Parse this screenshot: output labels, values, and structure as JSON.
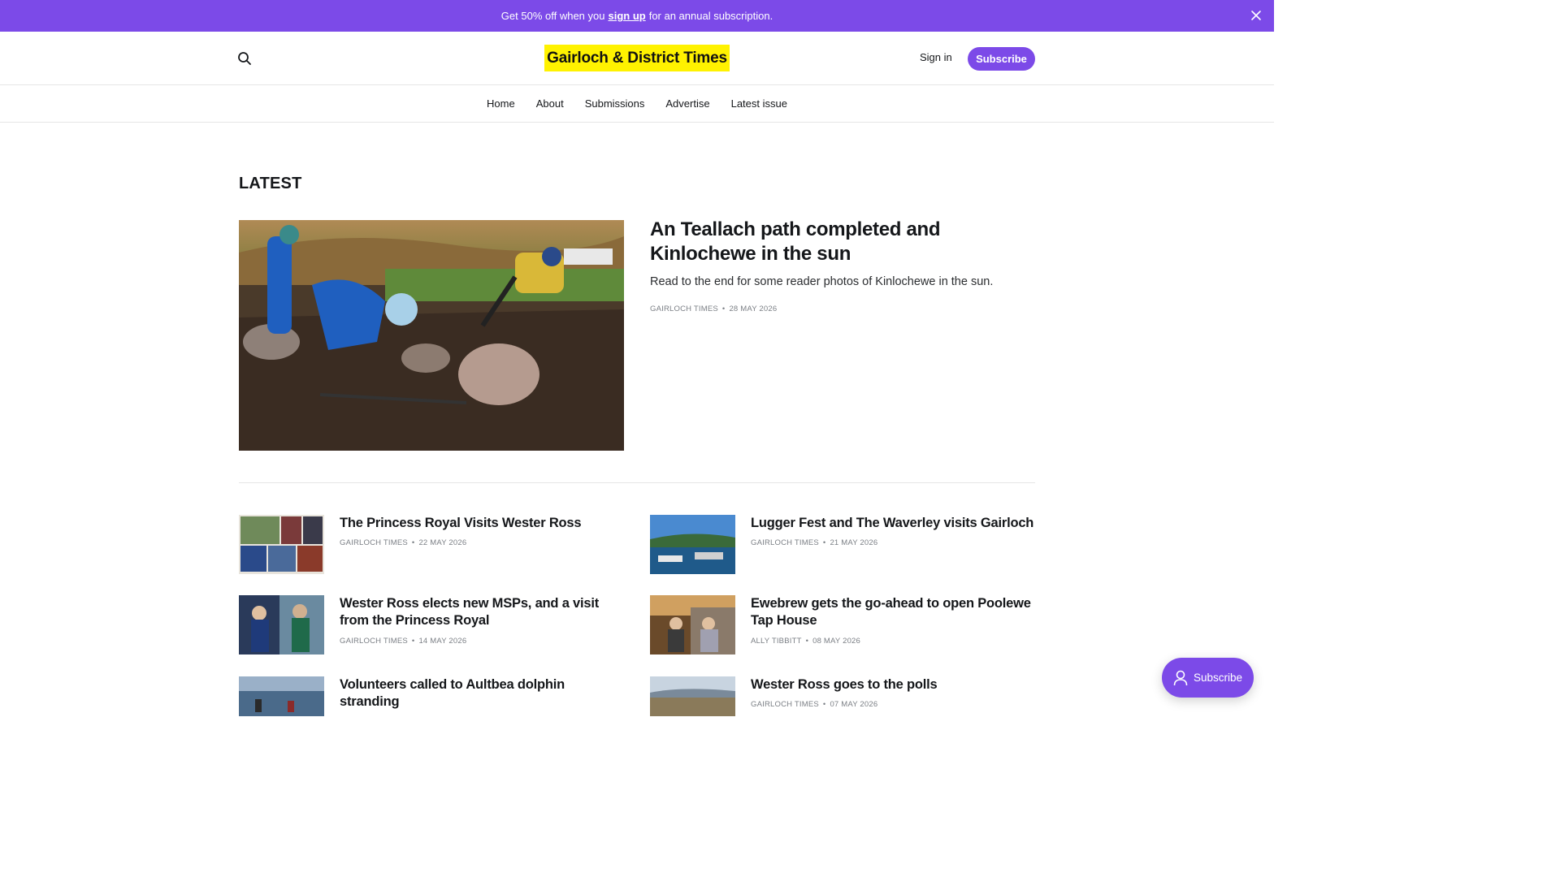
{
  "announcement": {
    "prefix": "Get 50% off when you",
    "link": "sign up",
    "suffix": "for an annual subscription."
  },
  "header": {
    "logo_text": "Gairloch & District Times",
    "signin_label": "Sign in",
    "subscribe_label": "Subscribe"
  },
  "nav": [
    "Home",
    "About",
    "Submissions",
    "Advertise",
    "Latest issue"
  ],
  "latest": {
    "heading": "LATEST",
    "feature": {
      "title": "An Teallach path completed and Kinlochewe in the sun",
      "excerpt": "Read to the end for some reader photos of Kinlochewe in the sun.",
      "author": "GAIRLOCH TIMES",
      "date": "28 MAY 2026"
    },
    "posts": [
      {
        "title": "The Princess Royal Visits Wester Ross",
        "author": "GAIRLOCH TIMES",
        "date": "22 MAY 2026"
      },
      {
        "title": "Lugger Fest and The Waverley visits Gairloch",
        "author": "GAIRLOCH TIMES",
        "date": "21 MAY 2026"
      },
      {
        "title": "Wester Ross elects new MSPs, and a visit from the Princess Royal",
        "author": "GAIRLOCH TIMES",
        "date": "14 MAY 2026"
      },
      {
        "title": "Ewebrew gets the go-ahead to open Poolewe Tap House",
        "author": "ALLY TIBBITT",
        "date": "08 MAY 2026"
      },
      {
        "title": "Volunteers called to Aultbea dolphin stranding",
        "author": "",
        "date": ""
      },
      {
        "title": "Wester Ross goes to the polls",
        "author": "GAIRLOCH TIMES",
        "date": "07 MAY 2026"
      }
    ]
  },
  "floating_subscribe_label": "Subscribe",
  "colors": {
    "accent": "#7c4ae8",
    "logo_bg": "#fff200"
  }
}
